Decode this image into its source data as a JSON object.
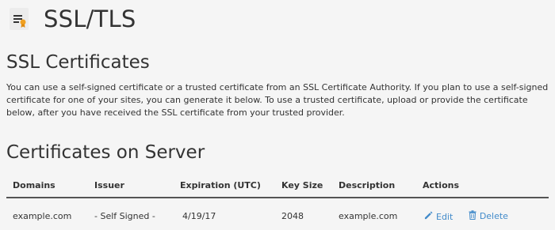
{
  "header": {
    "title": "SSL/TLS",
    "icon": "ssl-certificate-icon"
  },
  "ssl_certificates": {
    "title": "SSL Certificates",
    "description": "You can use a self-signed certificate or a trusted certificate from an SSL Certificate Authority. If you plan to use a self-signed certificate for one of your sites, you can generate it below. To use a trusted certificate, upload or provide the certificate below, after you have received the SSL certificate from your trusted provider."
  },
  "certificates_on_server": {
    "title": "Certificates on Server",
    "columns": [
      "Domains",
      "Issuer",
      "Expiration (UTC)",
      "Key Size",
      "Description",
      "Actions"
    ],
    "rows": [
      {
        "domains": "example.com",
        "issuer": "- Self Signed -",
        "expiration": "4/19/17",
        "key_size": "2048",
        "description": "example.com",
        "actions": {
          "edit_label": "Edit",
          "edit_icon": "pencil-icon",
          "delete_label": "Delete",
          "delete_icon": "trash-icon"
        }
      }
    ]
  },
  "colors": {
    "link": "#428bca",
    "text": "#333333",
    "background": "#f5f5f5"
  }
}
